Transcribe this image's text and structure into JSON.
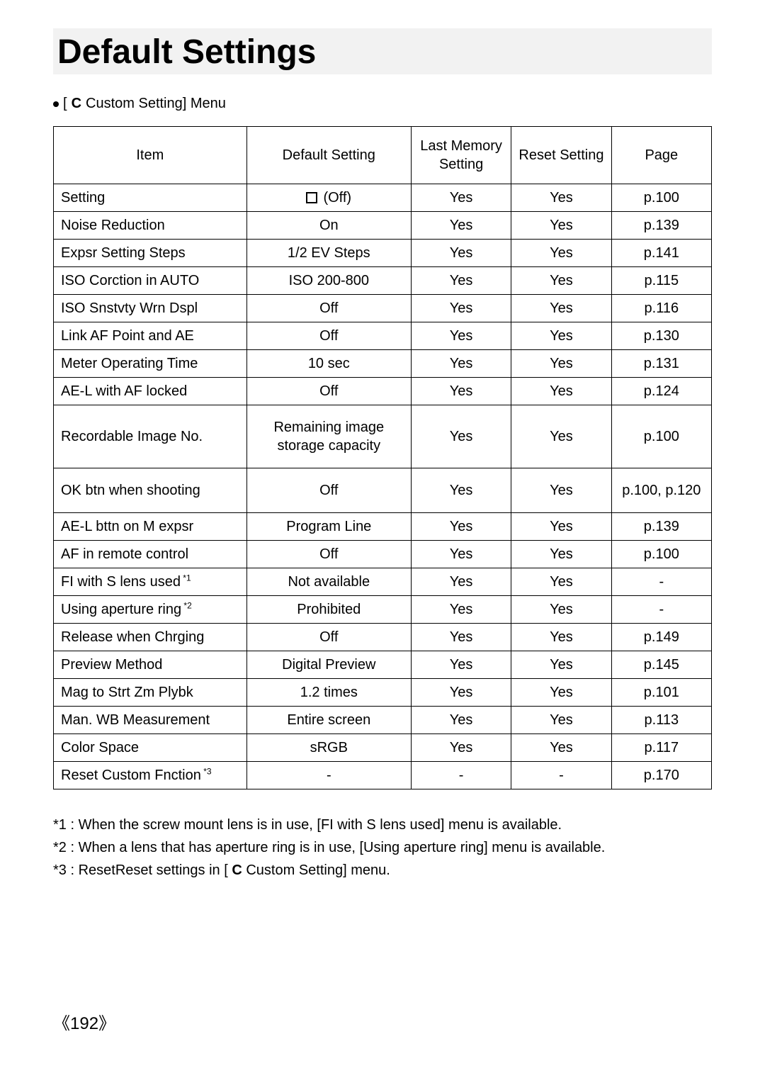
{
  "title": "Default Settings",
  "menu_label_prefix": "[ ",
  "menu_icon": "C",
  "menu_label_suffix": " Custom Setting] Menu",
  "headers": {
    "item": "Item",
    "default": "Default Setting",
    "last_memory": "Last Memory Setting",
    "reset": "Reset Setting",
    "page": "Page"
  },
  "rows": [
    {
      "item": "Setting",
      "default_prefix_icon": "checkbox",
      "default": "(Off)",
      "last_memory": "Yes",
      "reset": "Yes",
      "page": "p.100"
    },
    {
      "item": "Noise Reduction",
      "default": "On",
      "last_memory": "Yes",
      "reset": "Yes",
      "page": "p.139"
    },
    {
      "item": "Expsr Setting Steps",
      "default": "1/2 EV Steps",
      "last_memory": "Yes",
      "reset": "Yes",
      "page": "p.141"
    },
    {
      "item": "ISO Corction in AUTO",
      "default": "ISO 200-800",
      "last_memory": "Yes",
      "reset": "Yes",
      "page": "p.115"
    },
    {
      "item": "ISO Snstvty Wrn Dspl",
      "default": "Off",
      "last_memory": "Yes",
      "reset": "Yes",
      "page": "p.116"
    },
    {
      "item": "Link AF Point and AE",
      "default": "Off",
      "last_memory": "Yes",
      "reset": "Yes",
      "page": "p.130"
    },
    {
      "item": "Meter Operating Time",
      "default": "10 sec",
      "last_memory": "Yes",
      "reset": "Yes",
      "page": "p.131"
    },
    {
      "item": "AE-L with AF locked",
      "default": "Off",
      "last_memory": "Yes",
      "reset": "Yes",
      "page": "p.124"
    },
    {
      "item": "Recordable Image No.",
      "default": "Remaining image storage capacity",
      "last_memory": "Yes",
      "reset": "Yes",
      "page": "p.100",
      "tall": true
    },
    {
      "item": "OK btn when shooting",
      "default": "Off",
      "last_memory": "Yes",
      "reset": "Yes",
      "page": "p.100, p.120",
      "tall": true
    },
    {
      "item": "AE-L bttn on M expsr",
      "default": "Program Line",
      "last_memory": "Yes",
      "reset": "Yes",
      "page": "p.139"
    },
    {
      "item": "AF in remote control",
      "default": "Off",
      "last_memory": "Yes",
      "reset": "Yes",
      "page": "p.100"
    },
    {
      "item": "FI with S lens used",
      "item_sup": "*1",
      "default": "Not available",
      "last_memory": "Yes",
      "reset": "Yes",
      "page": "-"
    },
    {
      "item": "Using aperture ring",
      "item_sup": "*2",
      "default": "Prohibited",
      "last_memory": "Yes",
      "reset": "Yes",
      "page": "-"
    },
    {
      "item": "Release when Chrging",
      "default": "Off",
      "last_memory": "Yes",
      "reset": "Yes",
      "page": "p.149"
    },
    {
      "item": "Preview Method",
      "default": "Digital Preview",
      "last_memory": "Yes",
      "reset": "Yes",
      "page": "p.145"
    },
    {
      "item": "Mag to Strt Zm Plybk",
      "default": "1.2 times",
      "last_memory": "Yes",
      "reset": "Yes",
      "page": "p.101"
    },
    {
      "item": "Man. WB Measurement",
      "default": "Entire screen",
      "last_memory": "Yes",
      "reset": "Yes",
      "page": "p.113"
    },
    {
      "item": "Color Space",
      "default": "sRGB",
      "last_memory": "Yes",
      "reset": "Yes",
      "page": "p.117"
    },
    {
      "item": "Reset Custom Fnction",
      "item_sup": "*3",
      "default": "-",
      "last_memory": "-",
      "reset": "-",
      "page": "p.170"
    }
  ],
  "footnotes": [
    "*1 : When the screw mount lens is in use, [FI with S lens used] menu is available.",
    "*2 : When a lens that has aperture ring is in use, [Using aperture ring] menu is available."
  ],
  "footnote3_prefix": "*3 : ResetReset settings in [ ",
  "footnote3_icon": "C",
  "footnote3_suffix": " Custom Setting] menu.",
  "page_number": "《192》"
}
